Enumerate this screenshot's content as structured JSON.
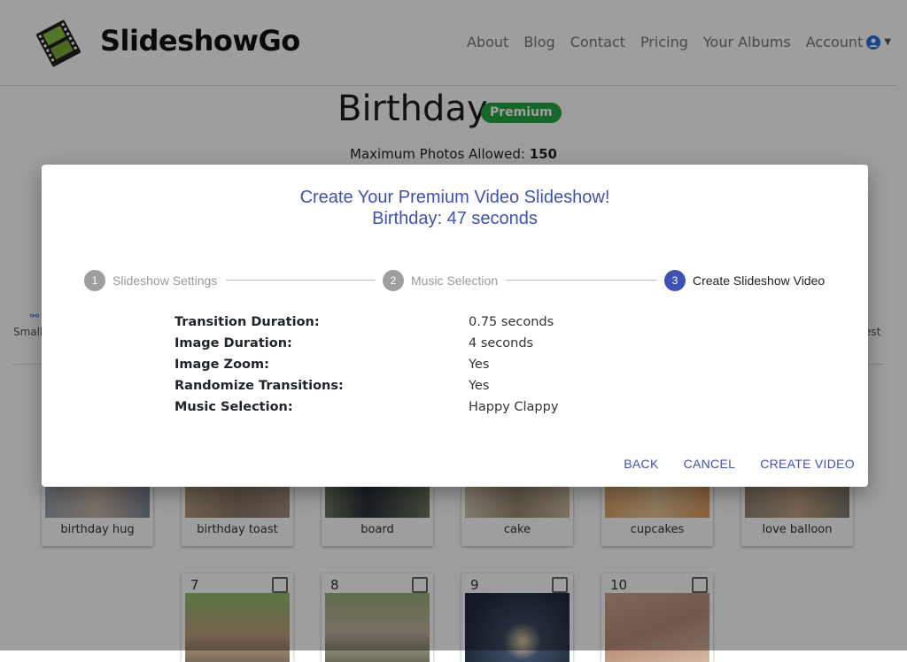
{
  "navbar": {
    "brand": "SlideshowGo",
    "links": [
      "About",
      "Blog",
      "Contact",
      "Pricing",
      "Your Albums"
    ],
    "account_label": "Account"
  },
  "album": {
    "title": "Birthday",
    "badge": "Premium",
    "max_photos_label": "Maximum Photos Allowed:",
    "max_photos_value": "150"
  },
  "background_controls": {
    "left_label": "Smalle",
    "right_label": "est"
  },
  "photo_cards": [
    {
      "caption": "birthday hug"
    },
    {
      "caption": "birthday toast"
    },
    {
      "caption": "board"
    },
    {
      "caption": "cake"
    },
    {
      "caption": "cupcakes"
    },
    {
      "caption": "love balloon"
    }
  ],
  "photo_cards_row2": [
    {
      "number": "7"
    },
    {
      "number": "8"
    },
    {
      "number": "9"
    },
    {
      "number": "10"
    }
  ],
  "modal": {
    "title_line1": "Create Your Premium Video Slideshow!",
    "title_line2": "Birthday: 47 seconds",
    "steps": [
      {
        "number": "1",
        "label": "Slideshow Settings",
        "active": false
      },
      {
        "number": "2",
        "label": "Music Selection",
        "active": false
      },
      {
        "number": "3",
        "label": "Create Slideshow Video",
        "active": true
      }
    ],
    "summary": [
      {
        "label": "Transition Duration:",
        "value": "0.75 seconds"
      },
      {
        "label": "Image Duration:",
        "value": "4 seconds"
      },
      {
        "label": "Image Zoom:",
        "value": "Yes"
      },
      {
        "label": "Randomize Transitions:",
        "value": "Yes"
      },
      {
        "label": "Music Selection:",
        "value": "Happy Clappy"
      }
    ],
    "actions": {
      "back": "BACK",
      "cancel": "CANCEL",
      "create": "CREATE VIDEO"
    }
  },
  "colors": {
    "accent": "#3f51b5",
    "badge": "#28a745",
    "overlay": "rgba(0,0,0,0.38)"
  }
}
